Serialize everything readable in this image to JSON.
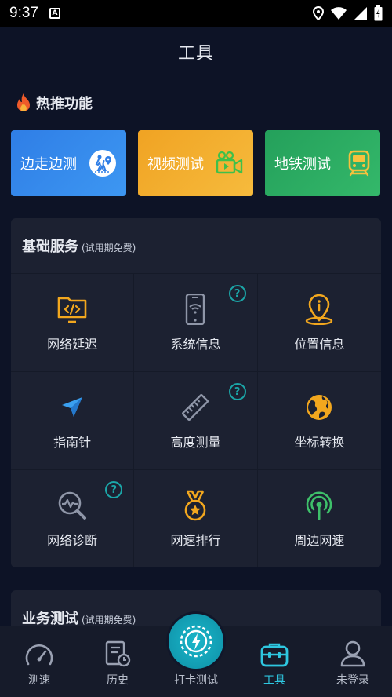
{
  "status": {
    "time": "9:37",
    "notif": "A"
  },
  "header": {
    "title": "工具"
  },
  "hot": {
    "heading": "热推功能",
    "cards": [
      {
        "label": "边走边测",
        "icon": "walking-map-icon"
      },
      {
        "label": "视频测试",
        "icon": "video-camera-icon"
      },
      {
        "label": "地铁测试",
        "icon": "subway-train-icon"
      }
    ]
  },
  "basic": {
    "title": "基础服务",
    "subtitle": "(试用期免费)",
    "items": [
      {
        "label": "网络延迟",
        "icon": "code-folder-icon",
        "help": false
      },
      {
        "label": "系统信息",
        "icon": "phone-wifi-icon",
        "help": true
      },
      {
        "label": "位置信息",
        "icon": "location-pin-icon",
        "help": false
      },
      {
        "label": "指南针",
        "icon": "compass-arrow-icon",
        "help": false
      },
      {
        "label": "高度测量",
        "icon": "ruler-icon",
        "help": true
      },
      {
        "label": "坐标转换",
        "icon": "globe-icon",
        "help": false
      },
      {
        "label": "网络诊断",
        "icon": "magnifier-pulse-icon",
        "help": true
      },
      {
        "label": "网速排行",
        "icon": "medal-icon",
        "help": false
      },
      {
        "label": "周边网速",
        "icon": "antenna-signal-icon",
        "help": false
      }
    ],
    "help_glyph": "?"
  },
  "business": {
    "title": "业务测试",
    "subtitle": "(试用期免费)"
  },
  "nav": [
    {
      "label": "测速"
    },
    {
      "label": "历史"
    },
    {
      "label": "打卡测试"
    },
    {
      "label": "工具"
    },
    {
      "label": "未登录"
    }
  ],
  "colors": {
    "accent": "#2ec7e0",
    "orange": "#f2a71e",
    "help": "#1ba6a8"
  }
}
